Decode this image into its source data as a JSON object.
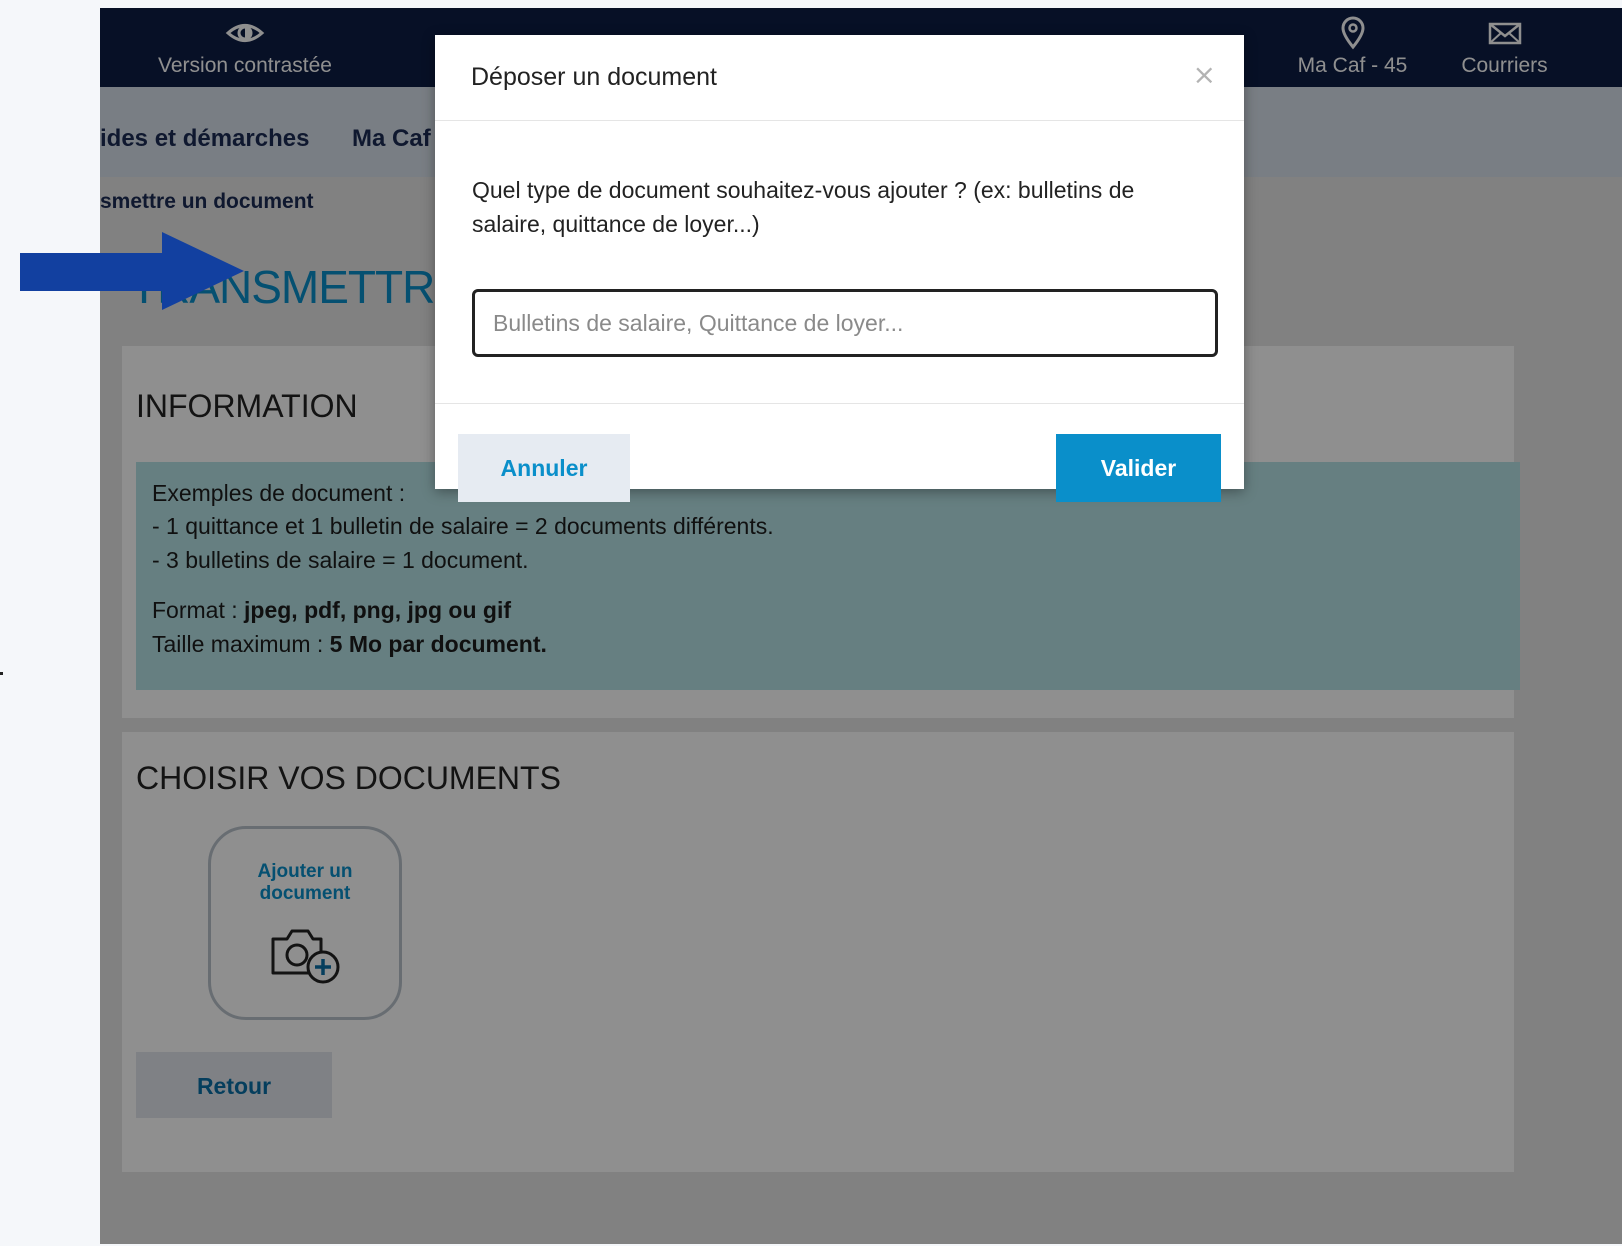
{
  "header": {
    "contrast_label": "Version contrastée",
    "location_label": "Ma Caf - 45",
    "mail_label": "Courriers"
  },
  "nav": {
    "items": [
      {
        "label": "ides et démarches"
      },
      {
        "label": "Ma Caf"
      }
    ]
  },
  "breadcrumb": "smettre un document",
  "page": {
    "title": "TRANSMETTRE"
  },
  "information": {
    "heading": "INFORMATION",
    "examples_title": "Exemples de document :",
    "example_1": "- 1 quittance et 1 bulletin de salaire = 2 documents différents.",
    "example_2": "- 3 bulletins de salaire = 1 document.",
    "format_label": "Format : ",
    "format_value": "jpeg, pdf, png, jpg ou gif",
    "size_label": "Taille maximum : ",
    "size_value": "5 Mo par document."
  },
  "documents": {
    "heading": "CHOISIR VOS DOCUMENTS",
    "add_label": "Ajouter un document",
    "back_label": "Retour"
  },
  "modal": {
    "title": "Déposer un document",
    "close_glyph": "×",
    "question": "Quel type de document souhaitez-vous ajouter ? (ex: bulletins de salaire, quittance de loyer...)",
    "input_placeholder": "Bulletins de salaire, Quittance de loyer...",
    "input_value": "",
    "cancel_label": "Annuler",
    "submit_label": "Valider"
  },
  "colors": {
    "accent": "#0a8fca",
    "topbar": "#0e1d45",
    "arrow": "#1240a0",
    "info_bg": "#b6e3e6"
  },
  "icons": {
    "contrast": "eye-icon",
    "location": "map-pin-icon",
    "mail": "envelope-icon",
    "add_document": "camera-plus-icon",
    "close": "close-icon",
    "annotation": "arrow-right-icon"
  }
}
